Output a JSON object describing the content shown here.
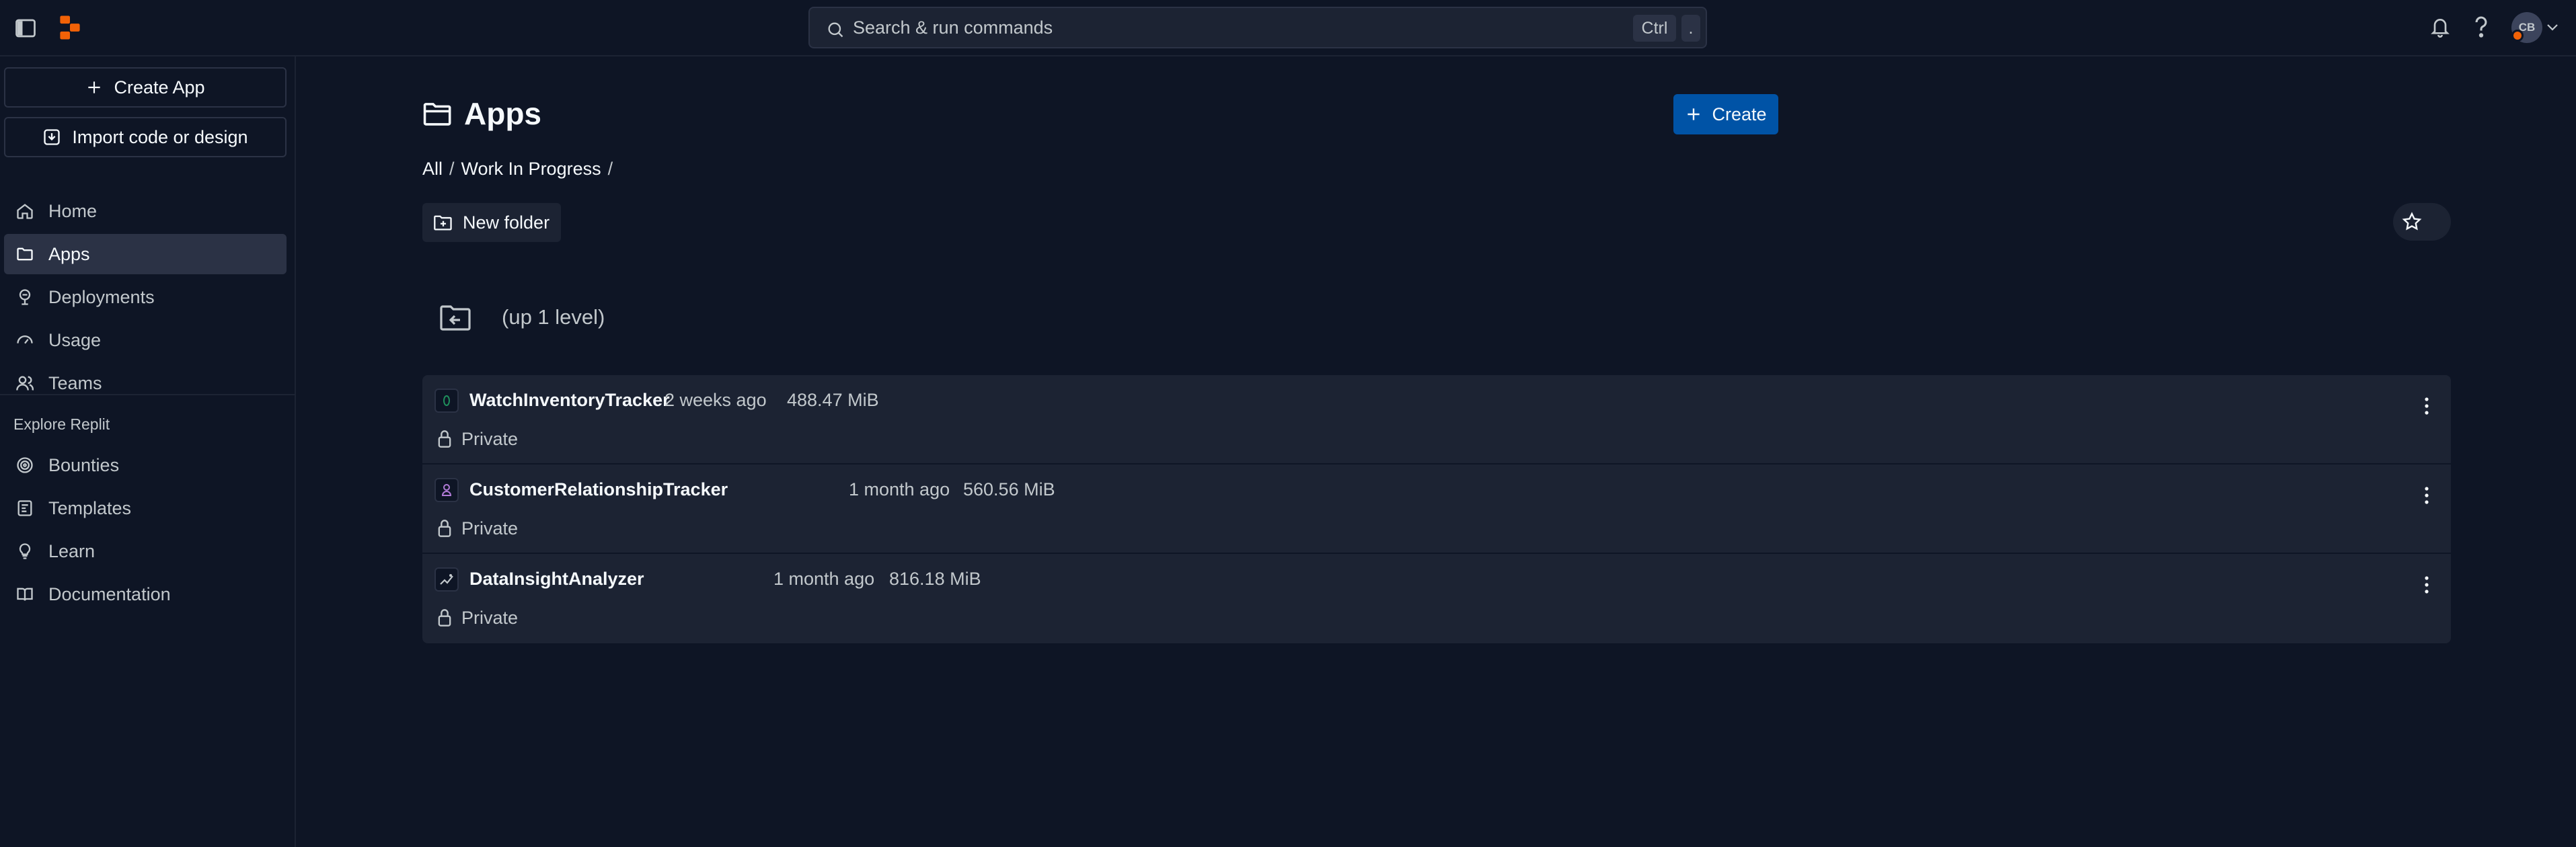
{
  "header": {
    "search_placeholder": "Search & run commands",
    "shortcut_ctrl": "Ctrl",
    "shortcut_key": ".",
    "avatar_initials": "CB"
  },
  "sidebar": {
    "create_app_label": "Create App",
    "import_label": "Import code or design",
    "nav": [
      {
        "label": "Home",
        "icon": "home-icon"
      },
      {
        "label": "Apps",
        "icon": "folder-icon",
        "active": true
      },
      {
        "label": "Deployments",
        "icon": "deployments-icon"
      },
      {
        "label": "Usage",
        "icon": "gauge-icon"
      },
      {
        "label": "Teams",
        "icon": "users-icon"
      }
    ],
    "explore_label": "Explore Replit",
    "explore": [
      {
        "label": "Bounties",
        "icon": "bounties-icon"
      },
      {
        "label": "Templates",
        "icon": "templates-icon"
      },
      {
        "label": "Learn",
        "icon": "lightbulb-icon"
      },
      {
        "label": "Documentation",
        "icon": "book-icon"
      }
    ]
  },
  "main": {
    "title": "Apps",
    "create_label": "Create",
    "breadcrumb": [
      "All",
      "/",
      "Work In Progress",
      "/"
    ],
    "new_folder_label": "New folder",
    "up_level_label": "(up 1 level)",
    "apps": [
      {
        "name": "WatchInventoryTracker",
        "updated": "2 weeks ago",
        "size": "488.47 MiB",
        "privacy": "Private"
      },
      {
        "name": "CustomerRelationshipTracker",
        "updated": "1 month ago",
        "size": "560.56 MiB",
        "privacy": "Private"
      },
      {
        "name": "DataInsightAnalyzer",
        "updated": "1 month ago",
        "size": "816.18 MiB",
        "privacy": "Private"
      }
    ]
  },
  "colors": {
    "background": "#0e1525",
    "surface": "#1c2333",
    "accent": "#0053a6",
    "brand": "#f26207"
  }
}
